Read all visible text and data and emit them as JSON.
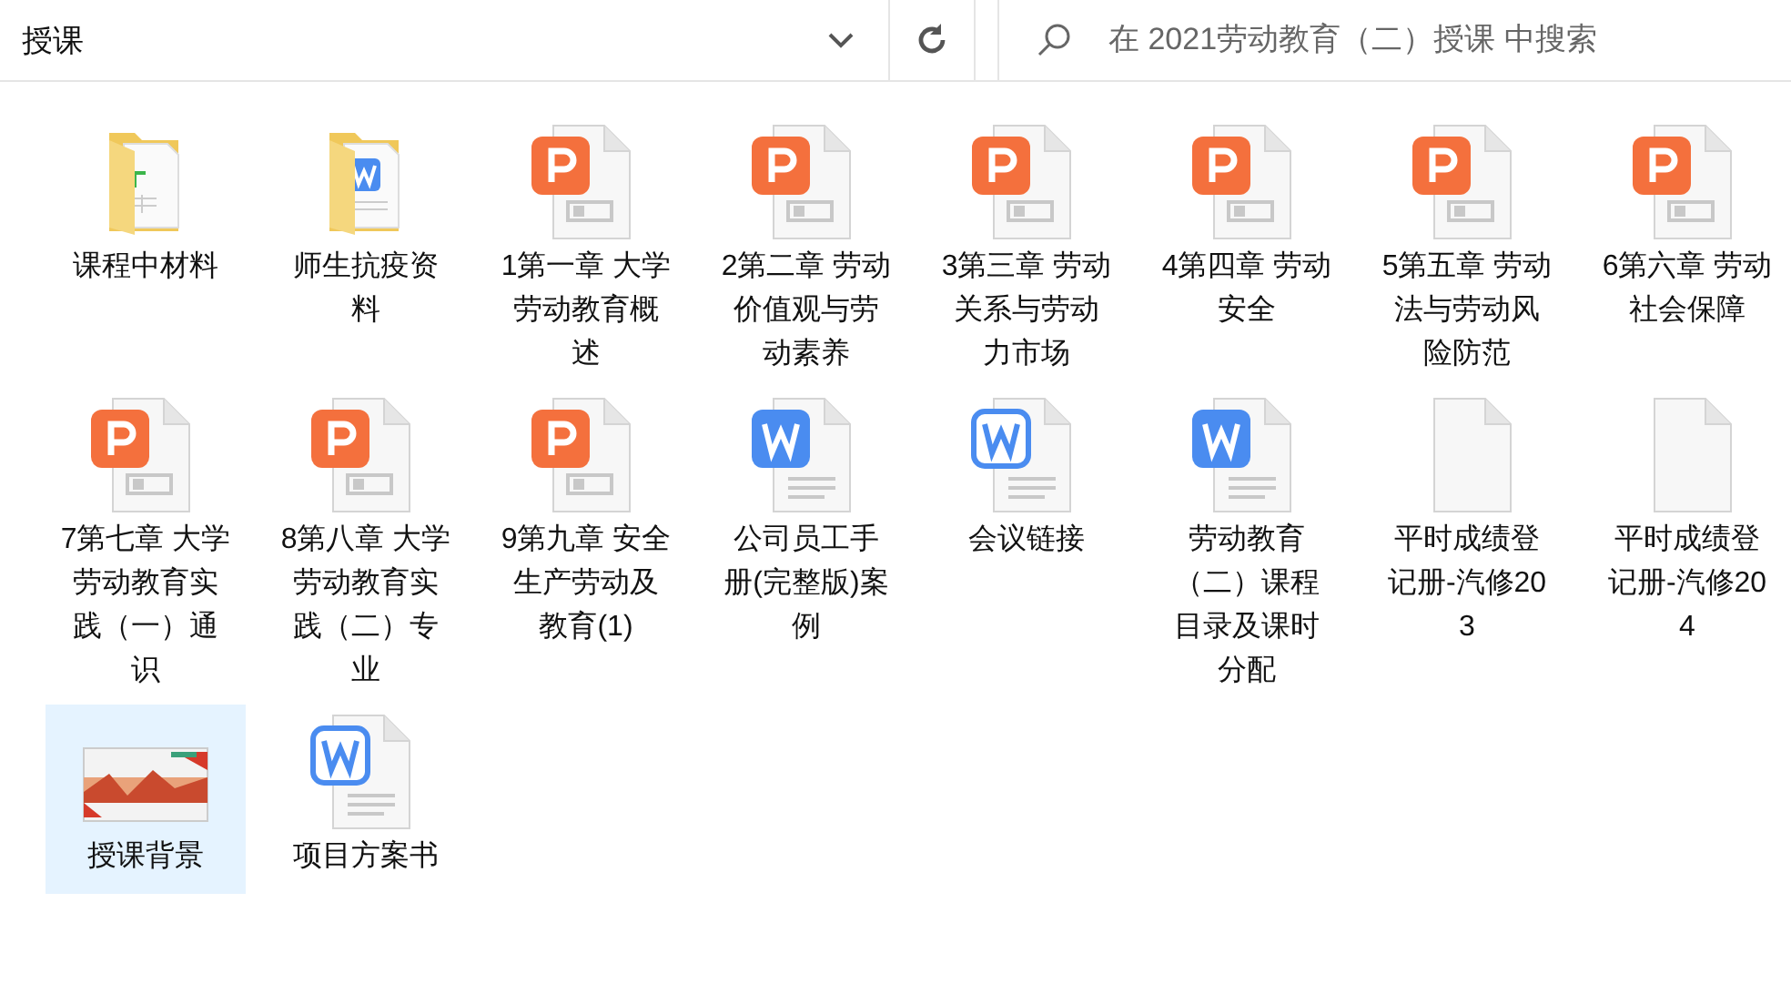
{
  "address_bar": {
    "path": "授课"
  },
  "search": {
    "placeholder": "在 2021劳动教育（二）授课 中搜索"
  },
  "files": [
    {
      "name": "课程中材料",
      "kind": "folder_sheet",
      "selected": false
    },
    {
      "name": "师生抗疫资料",
      "kind": "folder_doc",
      "selected": false
    },
    {
      "name": "1第一章 大学劳动教育概述",
      "kind": "ppt",
      "selected": false
    },
    {
      "name": "2第二章 劳动价值观与劳动素养",
      "kind": "ppt",
      "selected": false
    },
    {
      "name": "3第三章 劳动关系与劳动力市场",
      "kind": "ppt",
      "selected": false
    },
    {
      "name": "4第四章 劳动安全",
      "kind": "ppt",
      "selected": false
    },
    {
      "name": "5第五章 劳动法与劳动风险防范",
      "kind": "ppt",
      "selected": false
    },
    {
      "name": "6第六章 劳动社会保障",
      "kind": "ppt",
      "selected": false
    },
    {
      "name": "7第七章 大学劳动教育实践（一）通识",
      "kind": "ppt",
      "selected": false
    },
    {
      "name": "8第八章 大学劳动教育实践（二）专业",
      "kind": "ppt",
      "selected": false
    },
    {
      "name": "9第九章 安全生产劳动及教育(1)",
      "kind": "ppt",
      "selected": false
    },
    {
      "name": "公司员工手册(完整版)案例",
      "kind": "word",
      "selected": false
    },
    {
      "name": "会议链接",
      "kind": "word_outline",
      "selected": false
    },
    {
      "name": "劳动教育（二）课程目录及课时分配",
      "kind": "word",
      "selected": false
    },
    {
      "name": "平时成绩登记册-汽修203",
      "kind": "blank",
      "selected": false
    },
    {
      "name": "平时成绩登记册-汽修204",
      "kind": "blank",
      "selected": false
    },
    {
      "name": "授课背景",
      "selected": true
    },
    {
      "name": "项目方案书",
      "kind": "word_outline",
      "selected": false
    }
  ]
}
